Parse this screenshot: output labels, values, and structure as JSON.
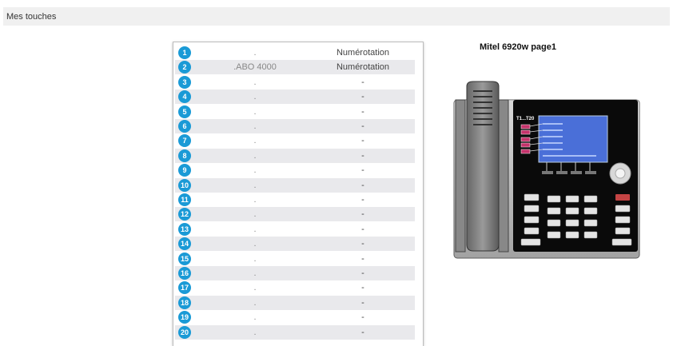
{
  "header": {
    "title": "Mes touches"
  },
  "keys": [
    {
      "num": "1",
      "label": ".",
      "function": "Numérotation"
    },
    {
      "num": "2",
      "label": ".ABO 4000",
      "function": "Numérotation"
    },
    {
      "num": "3",
      "label": ".",
      "function": "-"
    },
    {
      "num": "4",
      "label": ".",
      "function": "-"
    },
    {
      "num": "5",
      "label": ".",
      "function": "-"
    },
    {
      "num": "6",
      "label": ".",
      "function": "-"
    },
    {
      "num": "7",
      "label": ".",
      "function": "-"
    },
    {
      "num": "8",
      "label": ".",
      "function": "-"
    },
    {
      "num": "9",
      "label": ".",
      "function": "-"
    },
    {
      "num": "10",
      "label": ".",
      "function": "-"
    },
    {
      "num": "11",
      "label": ".",
      "function": "-"
    },
    {
      "num": "12",
      "label": ".",
      "function": "-"
    },
    {
      "num": "13",
      "label": ".",
      "function": "-"
    },
    {
      "num": "14",
      "label": ".",
      "function": "-"
    },
    {
      "num": "15",
      "label": ".",
      "function": "-"
    },
    {
      "num": "16",
      "label": ".",
      "function": "-"
    },
    {
      "num": "17",
      "label": ".",
      "function": "-"
    },
    {
      "num": "18",
      "label": ".",
      "function": "-"
    },
    {
      "num": "19",
      "label": ".",
      "function": "-"
    },
    {
      "num": "20",
      "label": ".",
      "function": "-"
    }
  ],
  "phone": {
    "title": "Mitel 6920w page1",
    "screen_label": "T1...T20"
  },
  "colors": {
    "badge": "#1a9ad6",
    "row_alt": "#e9e9ec",
    "screen": "#4a6fd8",
    "key_led": "#c4326a"
  }
}
